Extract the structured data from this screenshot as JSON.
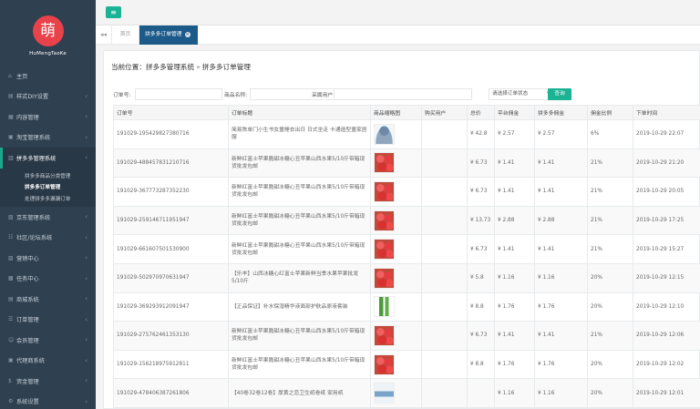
{
  "brand": {
    "logo_char": "萌",
    "name": "HuMengTaoKe"
  },
  "sidebar": {
    "items": [
      {
        "label": "主页",
        "icon": "home-icon",
        "glyph": "⌂",
        "has_children": false
      },
      {
        "label": "样式DIY设置",
        "icon": "paint-icon",
        "glyph": "▤",
        "has_children": true
      },
      {
        "label": "内容管理",
        "icon": "file-icon",
        "glyph": "▦",
        "has_children": true
      },
      {
        "label": "淘宝管理系统",
        "icon": "cart-icon",
        "glyph": "▣",
        "has_children": true
      },
      {
        "label": "拼多多管理系统",
        "icon": "cart-icon",
        "glyph": "▥",
        "has_children": true,
        "active": true
      },
      {
        "label": "京东管理系统",
        "icon": "store-icon",
        "glyph": "▧",
        "has_children": true
      },
      {
        "label": "社区/论坛系统",
        "icon": "users-icon",
        "glyph": "☷",
        "has_children": true
      },
      {
        "label": "营销中心",
        "icon": "chart-icon",
        "glyph": "▨",
        "has_children": true
      },
      {
        "label": "任务中心",
        "icon": "task-icon",
        "glyph": "▩",
        "has_children": true
      },
      {
        "label": "商城系统",
        "icon": "shop-icon",
        "glyph": "▤",
        "has_children": true
      },
      {
        "label": "订单管理",
        "icon": "list-icon",
        "glyph": "☰",
        "has_children": true
      },
      {
        "label": "会员管理",
        "icon": "user-icon",
        "glyph": "☺",
        "has_children": true
      },
      {
        "label": "代理商系统",
        "icon": "agent-icon",
        "glyph": "▣",
        "has_children": true
      },
      {
        "label": "资金管理",
        "icon": "money-icon",
        "glyph": "$",
        "has_children": true
      },
      {
        "label": "系统设置",
        "icon": "gear-icon",
        "glyph": "⚙",
        "has_children": true
      }
    ],
    "submenu": [
      {
        "label": "拼多多商品分类管理",
        "current": false
      },
      {
        "label": "拼多多订单管理",
        "current": true
      },
      {
        "label": "处理拼多多漏漏订单",
        "current": false
      }
    ]
  },
  "topbar": {
    "toggle_glyph": "≡"
  },
  "tabs": {
    "back_glyph": "◂◂",
    "home": "首页",
    "active": "拼多多订单管理",
    "close_glyph": "×"
  },
  "breadcrumb": {
    "prefix": "当前位置：",
    "level1": "拼多多管理系统",
    "sep": "»",
    "level2": "拼多多订单管理"
  },
  "filters": {
    "order_no_label": "订单号:",
    "product_label": "商品名称:",
    "buyer_label": "采属用户",
    "status_placeholder": "请选择订单状态",
    "search_label": "查询"
  },
  "table": {
    "columns": [
      "订单号",
      "订单标题",
      "商品缩略图",
      "购买用户",
      "总价",
      "平台佣金",
      "拼多多佣金",
      "佣金比例",
      "下单时间"
    ],
    "rows": [
      {
        "order_no": "191029-195429827380716",
        "title": "简易陈单门小生书女童睡衣出日 日式坐走 卡通造型童家居服",
        "thumb": "person",
        "total": "¥ 42.8",
        "platform": "¥ 2.57",
        "pdd": "¥ 2.57",
        "ratio": "6%",
        "time": "2019-10-29 22:07"
      },
      {
        "order_no": "191029-488457831210716",
        "title": "新鲜红富士苹果脆甜冰糖心丑苹果山西水果5/10斤带箱现货批发包邮",
        "thumb": "apple",
        "total": "¥ 6.73",
        "platform": "¥ 1.41",
        "pdd": "¥ 1.41",
        "ratio": "21%",
        "time": "2019-10-29 21:20"
      },
      {
        "order_no": "191029-367773287352230",
        "title": "新鲜红富士苹果脆甜冰糖心丑苹果山西水果5/10斤带箱现货批发包邮",
        "thumb": "apple",
        "total": "¥ 6.73",
        "platform": "¥ 1.41",
        "pdd": "¥ 1.41",
        "ratio": "21%",
        "time": "2019-10-29 20:05"
      },
      {
        "order_no": "191029-259146711951947",
        "title": "新鲜红富士苹果脆甜冰糖心丑苹果山西水果5/10斤带箱现货批发包邮",
        "thumb": "apple",
        "total": "¥ 13.73",
        "platform": "¥ 2.88",
        "pdd": "¥ 2.88",
        "ratio": "21%",
        "time": "2019-10-29 17:25"
      },
      {
        "order_no": "191029-661607501530900",
        "title": "新鲜红富士苹果脆甜冰糖心丑苹果山西水果5/10斤带箱现货批发包邮",
        "thumb": "apple",
        "total": "¥ 6.73",
        "platform": "¥ 1.41",
        "pdd": "¥ 1.41",
        "ratio": "21%",
        "time": "2019-10-29 15:27"
      },
      {
        "order_no": "191029-502970970631947",
        "title": "【乐丰】山西冰糖心红富士苹果新鲜当季水果苹果批发5/10斤",
        "thumb": "apple",
        "total": "¥ 5.8",
        "platform": "¥ 1.16",
        "pdd": "¥ 1.16",
        "ratio": "20%",
        "time": "2019-10-29 12:15"
      },
      {
        "order_no": "191029-369293912091947",
        "title": "【正品保证】补水保湿精华液面部护肤品原液套装",
        "thumb": "jar",
        "total": "¥ 8.8",
        "platform": "¥ 1.76",
        "pdd": "¥ 1.76",
        "ratio": "20%",
        "time": "2019-10-29 12:10"
      },
      {
        "order_no": "191029-275762461353130",
        "title": "新鲜红富士苹果脆甜冰糖心丑苹果山西水果5/10斤带箱现货批发包邮",
        "thumb": "apple",
        "total": "¥ 6.73",
        "platform": "¥ 1.41",
        "pdd": "¥ 1.41",
        "ratio": "21%",
        "time": "2019-10-29 12:06"
      },
      {
        "order_no": "191029-156218975912811",
        "title": "新鲜红富士苹果脆甜冰糖心丑苹果山西水果5/10斤带箱现货批发包邮",
        "thumb": "apple",
        "total": "¥ 8.8",
        "platform": "¥ 1.76",
        "pdd": "¥ 1.76",
        "ratio": "20%",
        "time": "2019-10-29 12:02"
      },
      {
        "order_no": "191029-478406387261806",
        "title": "【40卷32卷12卷】厚黄之恋卫生纸卷纸 家用纸",
        "thumb": "bag",
        "total": "",
        "platform": "¥ 1.16",
        "pdd": "¥ 1.16",
        "ratio": "20%",
        "time": "2019-10-29 12:01"
      }
    ]
  }
}
